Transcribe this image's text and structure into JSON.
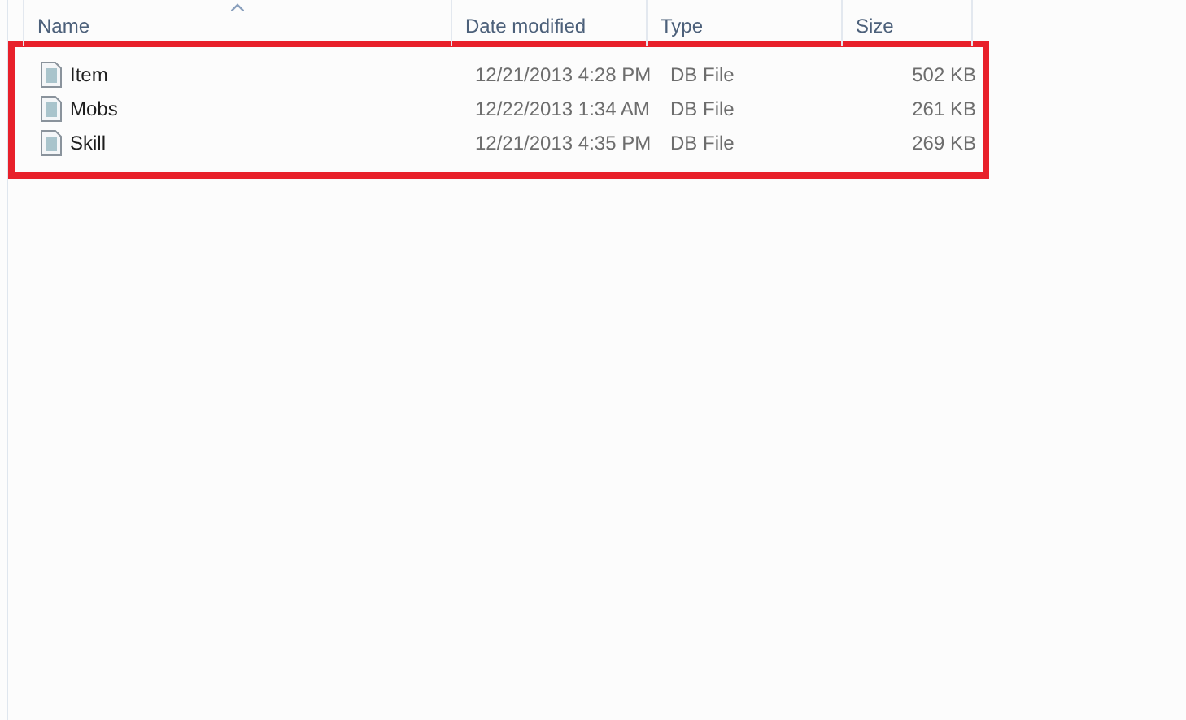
{
  "columns": [
    {
      "label": "Name",
      "sorted": true
    },
    {
      "label": "Date modified",
      "sorted": false
    },
    {
      "label": "Type",
      "sorted": false
    },
    {
      "label": "Size",
      "sorted": false
    }
  ],
  "files": [
    {
      "name": "Item",
      "date": "12/21/2013 4:28 PM",
      "type": "DB File",
      "size": "502 KB"
    },
    {
      "name": "Mobs",
      "date": "12/22/2013 1:34 AM",
      "type": "DB File",
      "size": "261 KB"
    },
    {
      "name": "Skill",
      "date": "12/21/2013 4:35 PM",
      "type": "DB File",
      "size": "269 KB"
    }
  ],
  "highlight": true
}
